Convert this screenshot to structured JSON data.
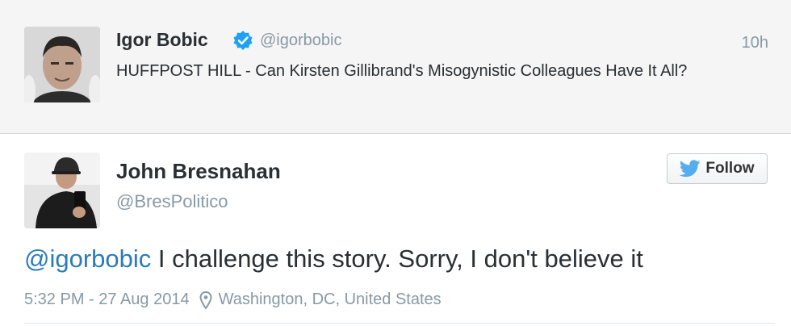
{
  "quoted_tweet": {
    "display_name": "Igor Bobic",
    "handle": "@igorbobic",
    "time": "10h",
    "text": "HUFFPOST HILL - Can Kirsten Gillibrand's Misogynistic Colleagues Have It All?"
  },
  "tweet": {
    "display_name": "John Bresnahan",
    "handle": "@BresPolitico",
    "follow_label": "Follow",
    "mention": "@igorbobic",
    "text": " I challenge this story. Sorry, I don't believe it",
    "timestamp": "5:32 PM - 27 Aug 2014",
    "location": "Washington, DC, United States"
  },
  "colors": {
    "link": "#2b7bb9",
    "verified": "#1da1f2",
    "twitter_bird": "#55acee",
    "muted": "#8899a6"
  },
  "icons": [
    "verified-badge-icon",
    "twitter-bird-icon",
    "location-pin-icon"
  ]
}
